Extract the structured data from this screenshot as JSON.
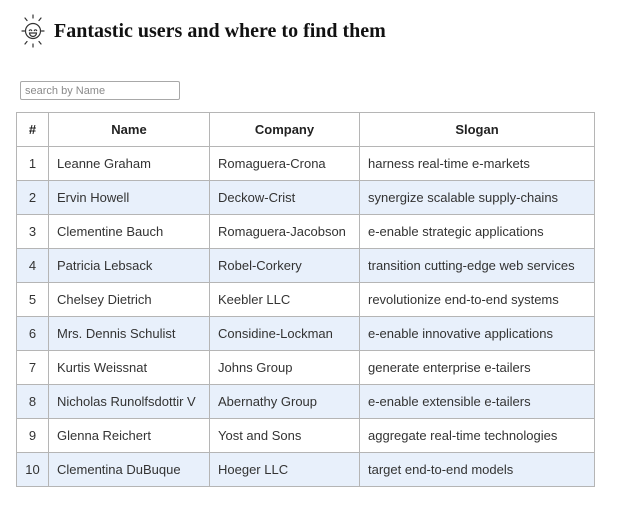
{
  "header": {
    "title": "Fantastic users and where to find them",
    "logo_icon": "smiley-sun-icon"
  },
  "search": {
    "placeholder": "search by Name",
    "value": ""
  },
  "table": {
    "columns": [
      "#",
      "Name",
      "Company",
      "Slogan"
    ],
    "rows": [
      {
        "id": "1",
        "name": "Leanne Graham",
        "company": "Romaguera-Crona",
        "slogan": "harness real-time e-markets"
      },
      {
        "id": "2",
        "name": "Ervin Howell",
        "company": "Deckow-Crist",
        "slogan": "synergize scalable supply-chains"
      },
      {
        "id": "3",
        "name": "Clementine Bauch",
        "company": "Romaguera-Jacobson",
        "slogan": "e-enable strategic applications"
      },
      {
        "id": "4",
        "name": "Patricia Lebsack",
        "company": "Robel-Corkery",
        "slogan": "transition cutting-edge web services"
      },
      {
        "id": "5",
        "name": "Chelsey Dietrich",
        "company": "Keebler LLC",
        "slogan": "revolutionize end-to-end systems"
      },
      {
        "id": "6",
        "name": "Mrs. Dennis Schulist",
        "company": "Considine-Lockman",
        "slogan": "e-enable innovative applications"
      },
      {
        "id": "7",
        "name": "Kurtis Weissnat",
        "company": "Johns Group",
        "slogan": "generate enterprise e-tailers"
      },
      {
        "id": "8",
        "name": "Nicholas Runolfsdottir V",
        "company": "Abernathy Group",
        "slogan": "e-enable extensible e-tailers"
      },
      {
        "id": "9",
        "name": "Glenna Reichert",
        "company": "Yost and Sons",
        "slogan": "aggregate real-time technologies"
      },
      {
        "id": "10",
        "name": "Clementina DuBuque",
        "company": "Hoeger LLC",
        "slogan": "target end-to-end models"
      }
    ]
  },
  "colors": {
    "row_alt": "#e8f0fb",
    "border": "#b5b5b5"
  }
}
